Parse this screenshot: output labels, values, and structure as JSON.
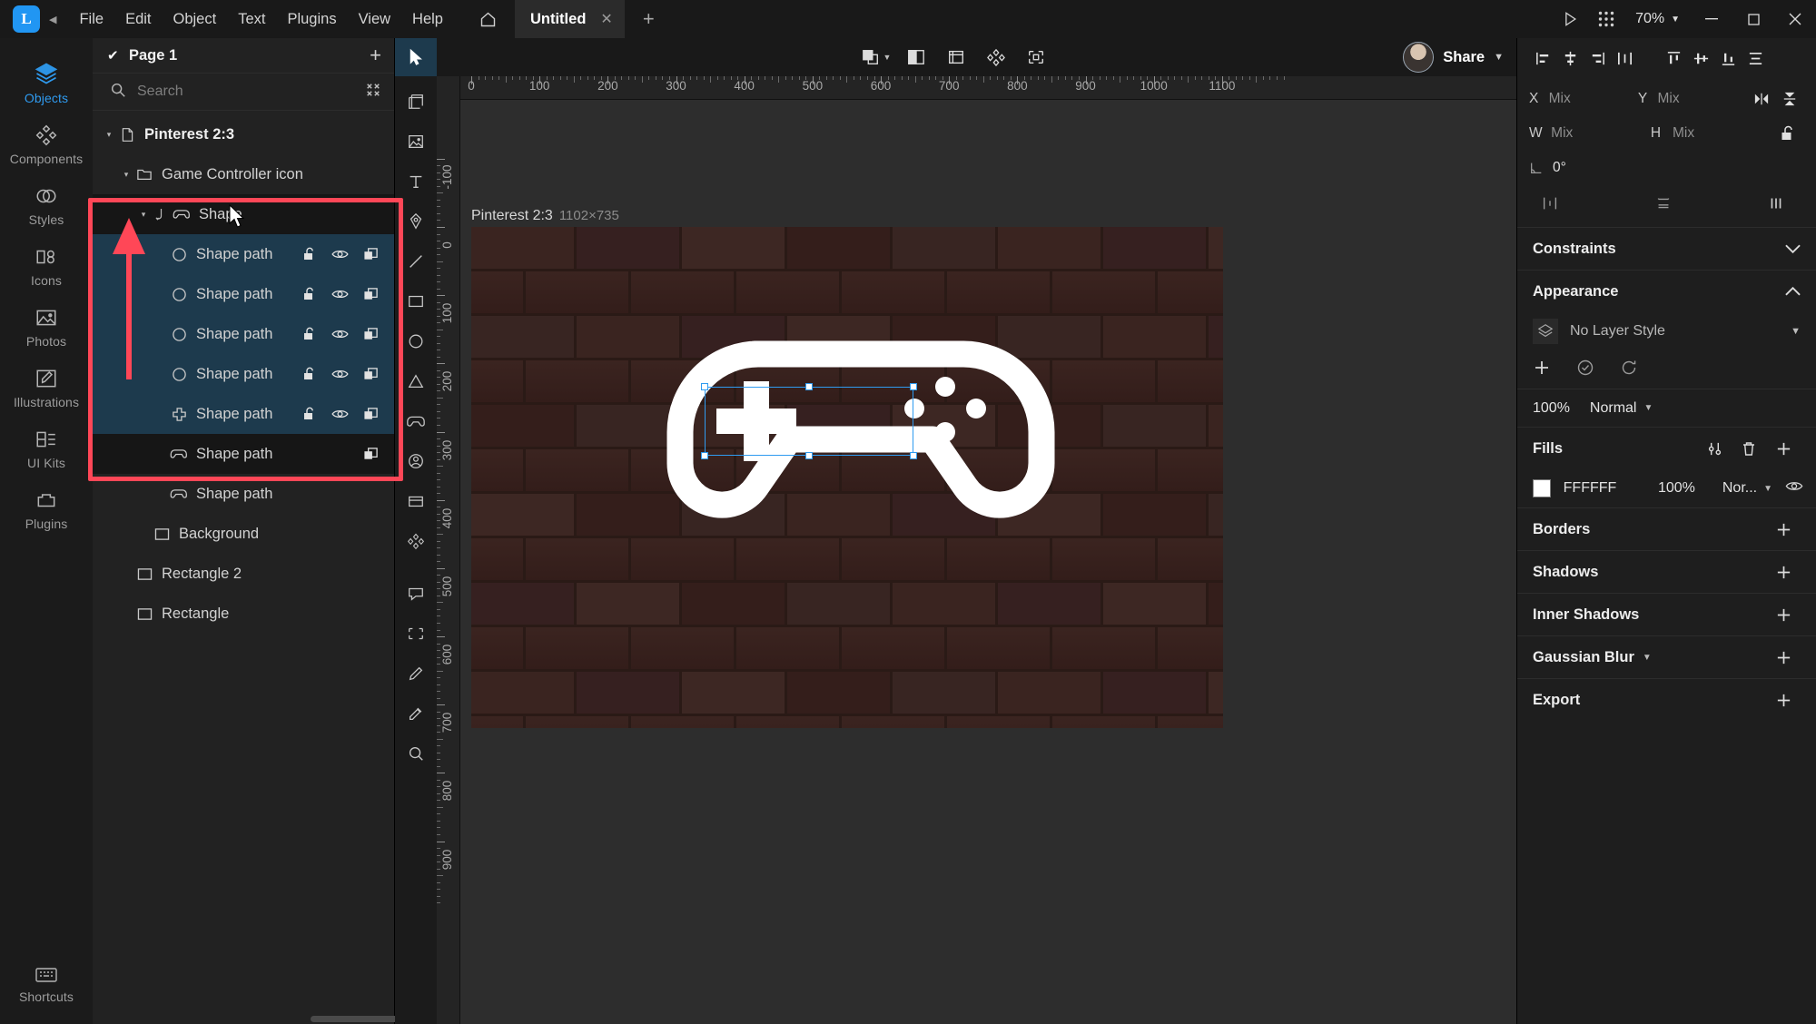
{
  "app": {
    "logo_letter": "L",
    "menus": [
      "File",
      "Edit",
      "Object",
      "Text",
      "Plugins",
      "View",
      "Help"
    ],
    "home_icon": "home-icon",
    "tab": {
      "title": "Untitled",
      "close": "✕",
      "add": "+"
    },
    "zoom": "70%",
    "window": {
      "minimize": "–",
      "maximize": "❐",
      "close": "✕"
    },
    "play_icon": "play-icon",
    "grid_icon": "apps-grid-icon"
  },
  "rail": {
    "items": [
      {
        "label": "Objects",
        "icon": "layers-icon",
        "active": true
      },
      {
        "label": "Components",
        "icon": "components-icon",
        "active": false
      },
      {
        "label": "Styles",
        "icon": "styles-icon",
        "active": false
      },
      {
        "label": "Icons",
        "icon": "icons-icon",
        "active": false
      },
      {
        "label": "Photos",
        "icon": "photos-icon",
        "active": false
      },
      {
        "label": "Illustrations",
        "icon": "illustrations-icon",
        "active": false
      },
      {
        "label": "UI Kits",
        "icon": "uikits-icon",
        "active": false
      },
      {
        "label": "Plugins",
        "icon": "plugins-icon",
        "active": false
      }
    ],
    "bottom": {
      "label": "Shortcuts",
      "icon": "keyboard-icon"
    }
  },
  "layers_panel": {
    "page": {
      "name": "Page 1",
      "check": "✔",
      "add": "+"
    },
    "search": {
      "placeholder": "Search",
      "icon": "search-icon",
      "collapse_icon": "collapse-icon"
    },
    "tree": [
      {
        "name": "Pinterest 2:3",
        "icon": "artboard-icon",
        "depth": 0,
        "twisty": "▾",
        "bold": true,
        "state": "none"
      },
      {
        "name": "Game Controller icon",
        "icon": "folder-icon",
        "depth": 1,
        "twisty": "▾",
        "bold": false,
        "state": "none"
      },
      {
        "name": "Shape",
        "icon": "controller-icon",
        "depth": 2,
        "twisty": "▾",
        "bold": false,
        "state": "highlight",
        "mask": true
      },
      {
        "name": "Shape path",
        "icon": "circle-icon",
        "depth": 3,
        "twisty": "",
        "bold": false,
        "state": "selected",
        "actions": [
          "lock-icon",
          "eye-icon",
          "copy-icon"
        ]
      },
      {
        "name": "Shape path",
        "icon": "circle-icon",
        "depth": 3,
        "twisty": "",
        "bold": false,
        "state": "selected",
        "actions": [
          "lock-icon",
          "eye-icon",
          "copy-icon"
        ]
      },
      {
        "name": "Shape path",
        "icon": "circle-icon",
        "depth": 3,
        "twisty": "",
        "bold": false,
        "state": "selected",
        "actions": [
          "lock-icon",
          "eye-icon",
          "copy-icon"
        ]
      },
      {
        "name": "Shape path",
        "icon": "circle-icon",
        "depth": 3,
        "twisty": "",
        "bold": false,
        "state": "selected",
        "actions": [
          "lock-icon",
          "eye-icon",
          "copy-icon"
        ]
      },
      {
        "name": "Shape path",
        "icon": "cross-icon",
        "depth": 3,
        "twisty": "",
        "bold": false,
        "state": "selected",
        "actions": [
          "lock-icon",
          "eye-icon",
          "copy-icon"
        ]
      },
      {
        "name": "Shape path",
        "icon": "controller-icon",
        "depth": 3,
        "twisty": "",
        "bold": false,
        "state": "highlight",
        "actions": [
          "copy-icon"
        ]
      },
      {
        "name": "Shape path",
        "icon": "controller-icon",
        "depth": 3,
        "twisty": "",
        "bold": false,
        "state": "none",
        "actions": []
      },
      {
        "name": "Background",
        "icon": "rect-icon",
        "depth": 2,
        "twisty": "",
        "bold": false,
        "state": "none",
        "actions": []
      },
      {
        "name": "Rectangle 2",
        "icon": "rect-icon",
        "depth": 1,
        "twisty": "",
        "bold": false,
        "state": "none",
        "actions": []
      },
      {
        "name": "Rectangle",
        "icon": "rect-icon",
        "depth": 1,
        "twisty": "",
        "bold": false,
        "state": "none",
        "actions": []
      }
    ]
  },
  "toolbar": {
    "pointer_icon": "pointer-tool-icon",
    "center_tools": [
      {
        "icon": "boolean-union-icon",
        "caret": true
      },
      {
        "icon": "mask-icon",
        "caret": false
      },
      {
        "icon": "flatten-icon",
        "caret": false
      },
      {
        "icon": "component-icon",
        "caret": false
      },
      {
        "icon": "export-slice-icon",
        "caret": false
      }
    ],
    "share_label": "Share",
    "avatar": "user-avatar"
  },
  "vtoolbar": [
    "artboard-tool-icon",
    "image-tool-icon",
    "text-tool-icon",
    "pen-tool-icon",
    "line-tool-icon",
    "rectangle-tool-icon",
    "ellipse-tool-icon",
    "triangle-tool-icon",
    "controller-shape-icon",
    "avatar-tool-icon",
    "card-tool-icon",
    "component-tool-icon",
    "comment-tool-icon",
    "slice-tool-icon",
    "pencil-tool-icon",
    "eyedropper-tool-icon",
    "zoom-tool-icon"
  ],
  "canvas": {
    "artboard_name": "Pinterest 2:3",
    "artboard_dims": "1102×735",
    "ruler_h_labels": [
      "0",
      "100",
      "200",
      "300",
      "400",
      "500",
      "600",
      "700",
      "800",
      "900",
      "1000",
      "1100"
    ],
    "ruler_v_labels": [
      "-100",
      "0",
      "100",
      "200",
      "300",
      "400",
      "500",
      "600",
      "700",
      "800",
      "900"
    ],
    "background_color": "#331d1a"
  },
  "inspector": {
    "align_row1": [
      "align-left-icon",
      "align-center-h-icon",
      "align-right-icon",
      "distribute-h-icon"
    ],
    "align_row2": [
      "align-top-icon",
      "align-middle-v-icon",
      "align-bottom-icon",
      "distribute-v-icon"
    ],
    "transform": {
      "x_label": "X",
      "x_value": "Mix",
      "y_label": "Y",
      "y_value": "Mix",
      "w_label": "W",
      "w_value": "Mix",
      "h_label": "H",
      "h_value": "Mix",
      "flip_h_icon": "flip-horizontal-icon",
      "flip_v_icon": "flip-vertical-icon",
      "lock_ratio_icon": "unlock-icon",
      "rotation_icon": "rotation-icon",
      "rotation_value": "0°",
      "row_icons": [
        "spacing-icon",
        "radius-icon",
        "columns-icon"
      ]
    },
    "sections": [
      {
        "title": "Constraints",
        "caret": "⌄",
        "collapsed": true
      },
      {
        "title": "Appearance",
        "caret": "⌃",
        "collapsed": false
      },
      {
        "title": "Borders",
        "action": "+"
      },
      {
        "title": "Shadows",
        "action": "+"
      },
      {
        "title": "Inner Shadows",
        "action": "+"
      },
      {
        "title": "Gaussian Blur",
        "action": "+",
        "caret": true
      },
      {
        "title": "Export",
        "action": "+"
      }
    ],
    "appearance": {
      "layer_style": "No Layer Style",
      "layer_style_icon": "layer-style-icon",
      "actions": [
        "add-icon",
        "apply-icon",
        "reset-icon"
      ],
      "opacity": "100%",
      "blend_mode": "Normal"
    },
    "fills": {
      "title": "Fills",
      "tools": [
        "settings-icon",
        "trash-icon",
        "add-icon"
      ],
      "items": [
        {
          "color": "#FFFFFF",
          "hex": "FFFFFF",
          "opacity": "100%",
          "blend": "Nor...",
          "visible_icon": "eye-icon"
        }
      ]
    }
  },
  "annotation": {
    "box_color": "#ff4757",
    "arrow_color": "#ff4757"
  }
}
